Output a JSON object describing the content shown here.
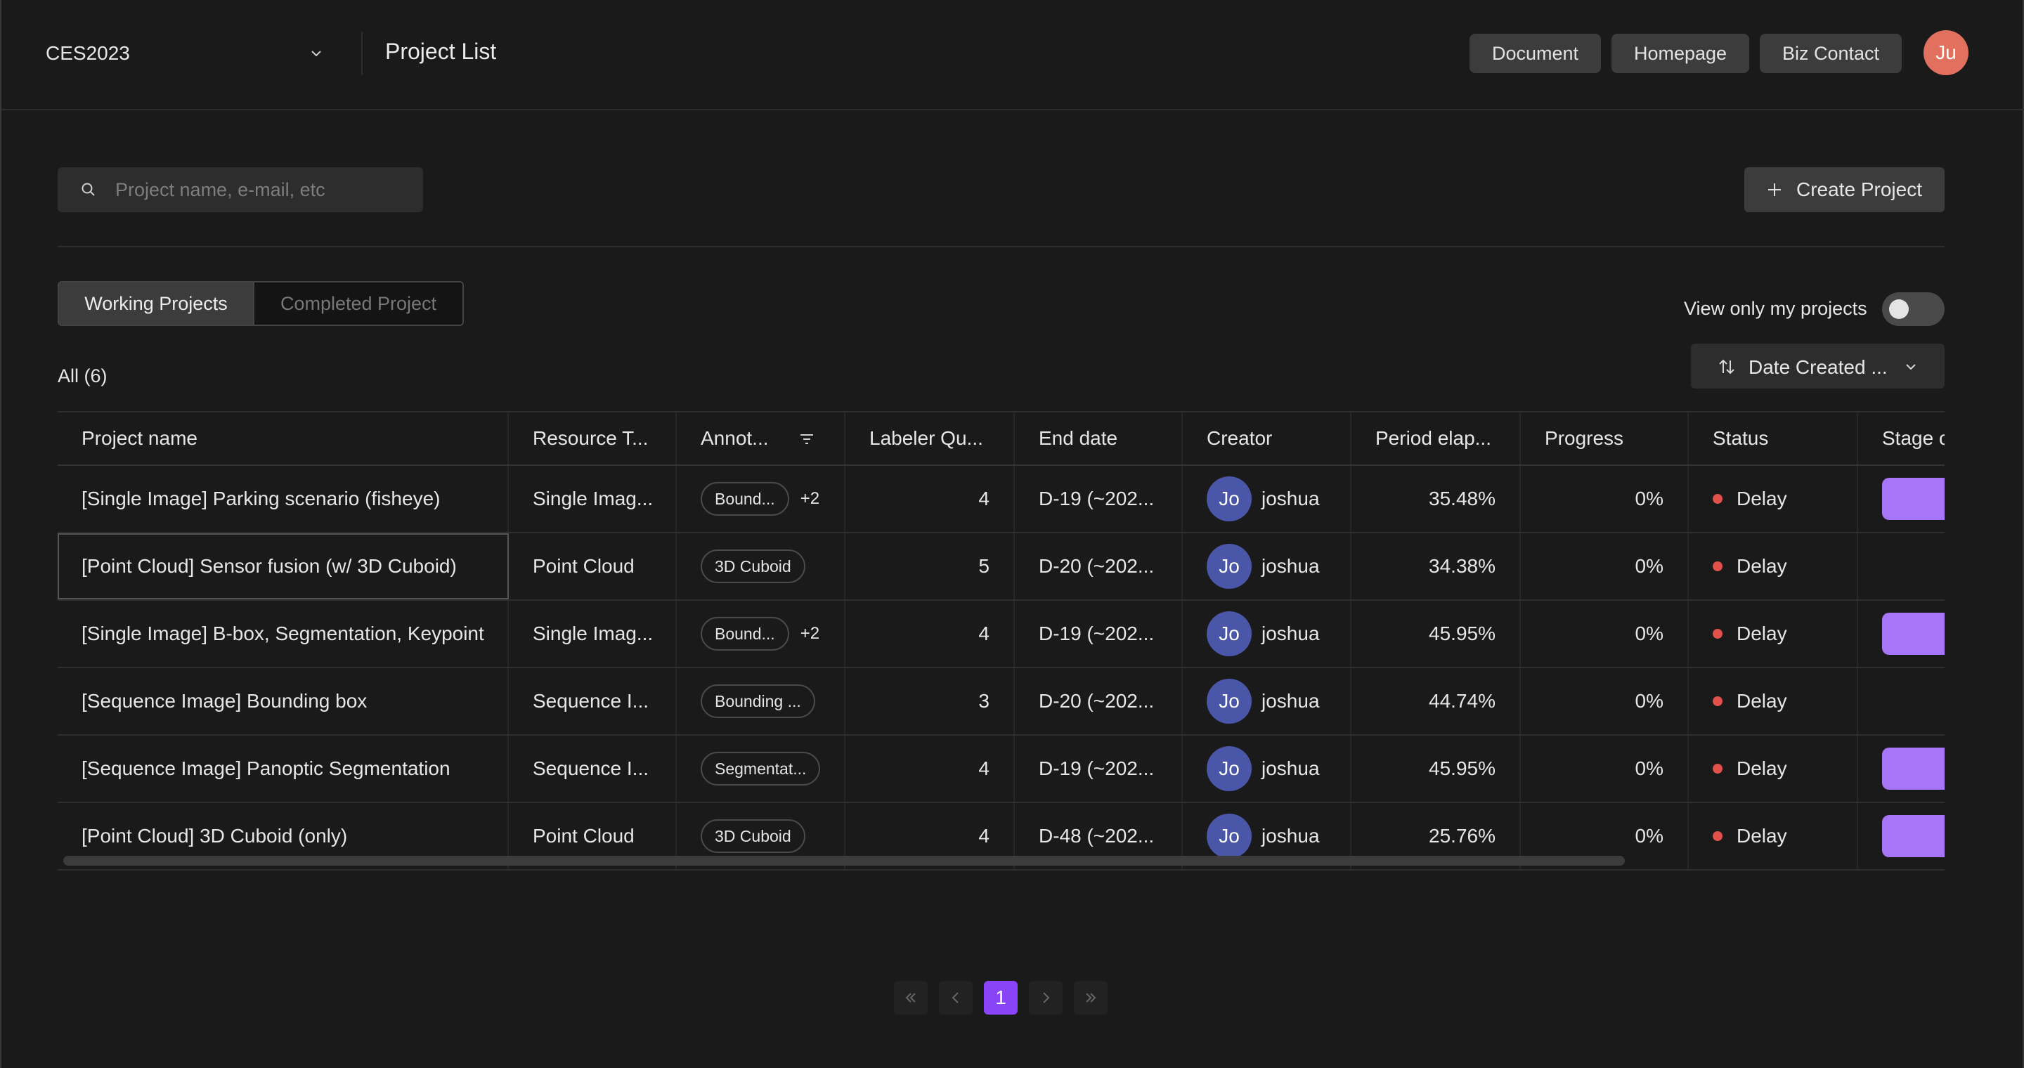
{
  "header": {
    "workspace": "CES2023",
    "title": "Project List",
    "buttons": [
      "Document",
      "Homepage",
      "Biz Contact"
    ],
    "user_initials": "Ju",
    "user_avatar_color": "#e2705f"
  },
  "toolbar": {
    "search_placeholder": "Project name, e-mail, etc",
    "search_value": "",
    "create_label": "Create Project"
  },
  "tabs": [
    {
      "label": "Working Projects",
      "active": true
    },
    {
      "label": "Completed Project",
      "active": false
    }
  ],
  "filters": {
    "my_projects_label": "View only my projects",
    "my_projects_on": false,
    "sort_label": "Date Created ...",
    "count_label": "All (6)"
  },
  "table": {
    "columns": [
      "Project name",
      "Resource T...",
      "Annot...",
      "Labeler Qu...",
      "End date",
      "Creator",
      "Period elap...",
      "Progress",
      "Status",
      "Stage c"
    ],
    "rows": [
      {
        "name": "[Single Image] Parking scenario (fisheye)",
        "resource": "Single Imag...",
        "annotation": "Bound...",
        "annotation_more": "+2",
        "labelers": "4",
        "end_date": "D-19 (~202...",
        "creator_initials": "Jo",
        "creator": "joshua",
        "elapsed": "35.48%",
        "progress": "0%",
        "status": "Delay",
        "stage": true
      },
      {
        "name": "[Point Cloud] Sensor fusion (w/ 3D Cuboid)",
        "resource": "Point Cloud",
        "annotation": "3D Cuboid",
        "annotation_more": "",
        "labelers": "5",
        "end_date": "D-20 (~202...",
        "creator_initials": "Jo",
        "creator": "joshua",
        "elapsed": "34.38%",
        "progress": "0%",
        "status": "Delay",
        "stage": false
      },
      {
        "name": "[Single Image] B-box, Segmentation, Keypoint",
        "resource": "Single Imag...",
        "annotation": "Bound...",
        "annotation_more": "+2",
        "labelers": "4",
        "end_date": "D-19 (~202...",
        "creator_initials": "Jo",
        "creator": "joshua",
        "elapsed": "45.95%",
        "progress": "0%",
        "status": "Delay",
        "stage": true
      },
      {
        "name": "[Sequence Image] Bounding box",
        "resource": "Sequence I...",
        "annotation": "Bounding ...",
        "annotation_more": "",
        "labelers": "3",
        "end_date": "D-20 (~202...",
        "creator_initials": "Jo",
        "creator": "joshua",
        "elapsed": "44.74%",
        "progress": "0%",
        "status": "Delay",
        "stage": false
      },
      {
        "name": "[Sequence Image] Panoptic Segmentation",
        "resource": "Sequence I...",
        "annotation": "Segmentat...",
        "annotation_more": "",
        "labelers": "4",
        "end_date": "D-19 (~202...",
        "creator_initials": "Jo",
        "creator": "joshua",
        "elapsed": "45.95%",
        "progress": "0%",
        "status": "Delay",
        "stage": true
      },
      {
        "name": "[Point Cloud] 3D Cuboid (only)",
        "resource": "Point Cloud",
        "annotation": "3D Cuboid",
        "annotation_more": "",
        "labelers": "4",
        "end_date": "D-48 (~202...",
        "creator_initials": "Jo",
        "creator": "joshua",
        "elapsed": "25.76%",
        "progress": "0%",
        "status": "Delay",
        "stage": true
      }
    ]
  },
  "pagination": {
    "current_page": "1"
  },
  "colors": {
    "accent": "#8a44f8",
    "stage": "#a675f8",
    "status_delay": "#e0524a",
    "creator_avatar": "#4a56a8"
  }
}
